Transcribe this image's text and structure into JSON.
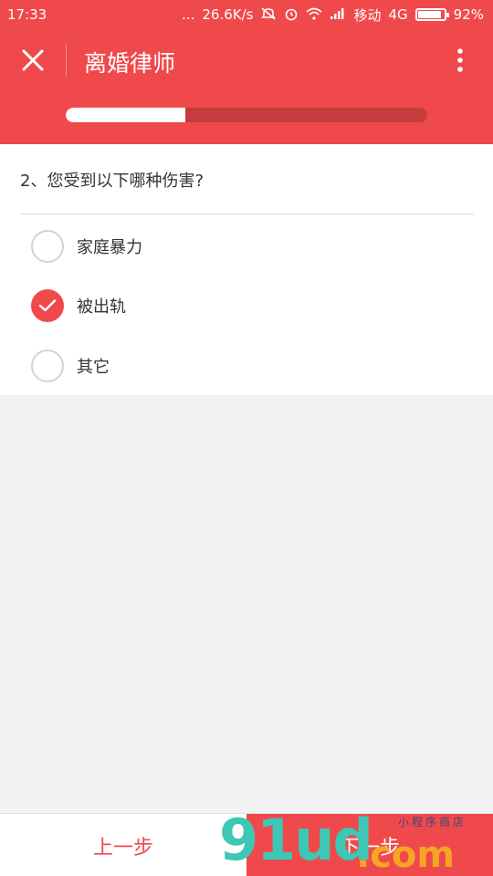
{
  "status_bar": {
    "time": "17:33",
    "dots": "...",
    "network_speed": "26.6K/s",
    "carrier": "移动",
    "network_type": "4G",
    "battery": "92%",
    "battery_level": 0.92
  },
  "header": {
    "title": "离婚律师",
    "progress": 0.33,
    "bg_color": "#f0494c"
  },
  "question": {
    "text": "2、您受到以下哪种伤害?",
    "options": [
      {
        "label": "家庭暴力",
        "checked": false
      },
      {
        "label": "被出轨",
        "checked": true
      },
      {
        "label": "其它",
        "checked": false
      }
    ]
  },
  "footer": {
    "prev_label": "上一步",
    "next_label": "下一步"
  },
  "watermark": {
    "logo_text": "91ud",
    "domain_text": ".com",
    "tagline": "小程序商店"
  },
  "colors": {
    "accent": "#f0494c",
    "progress_track": "#c63b3b",
    "watermark_teal": "#3cc8b4",
    "watermark_orange": "#f5a623"
  }
}
